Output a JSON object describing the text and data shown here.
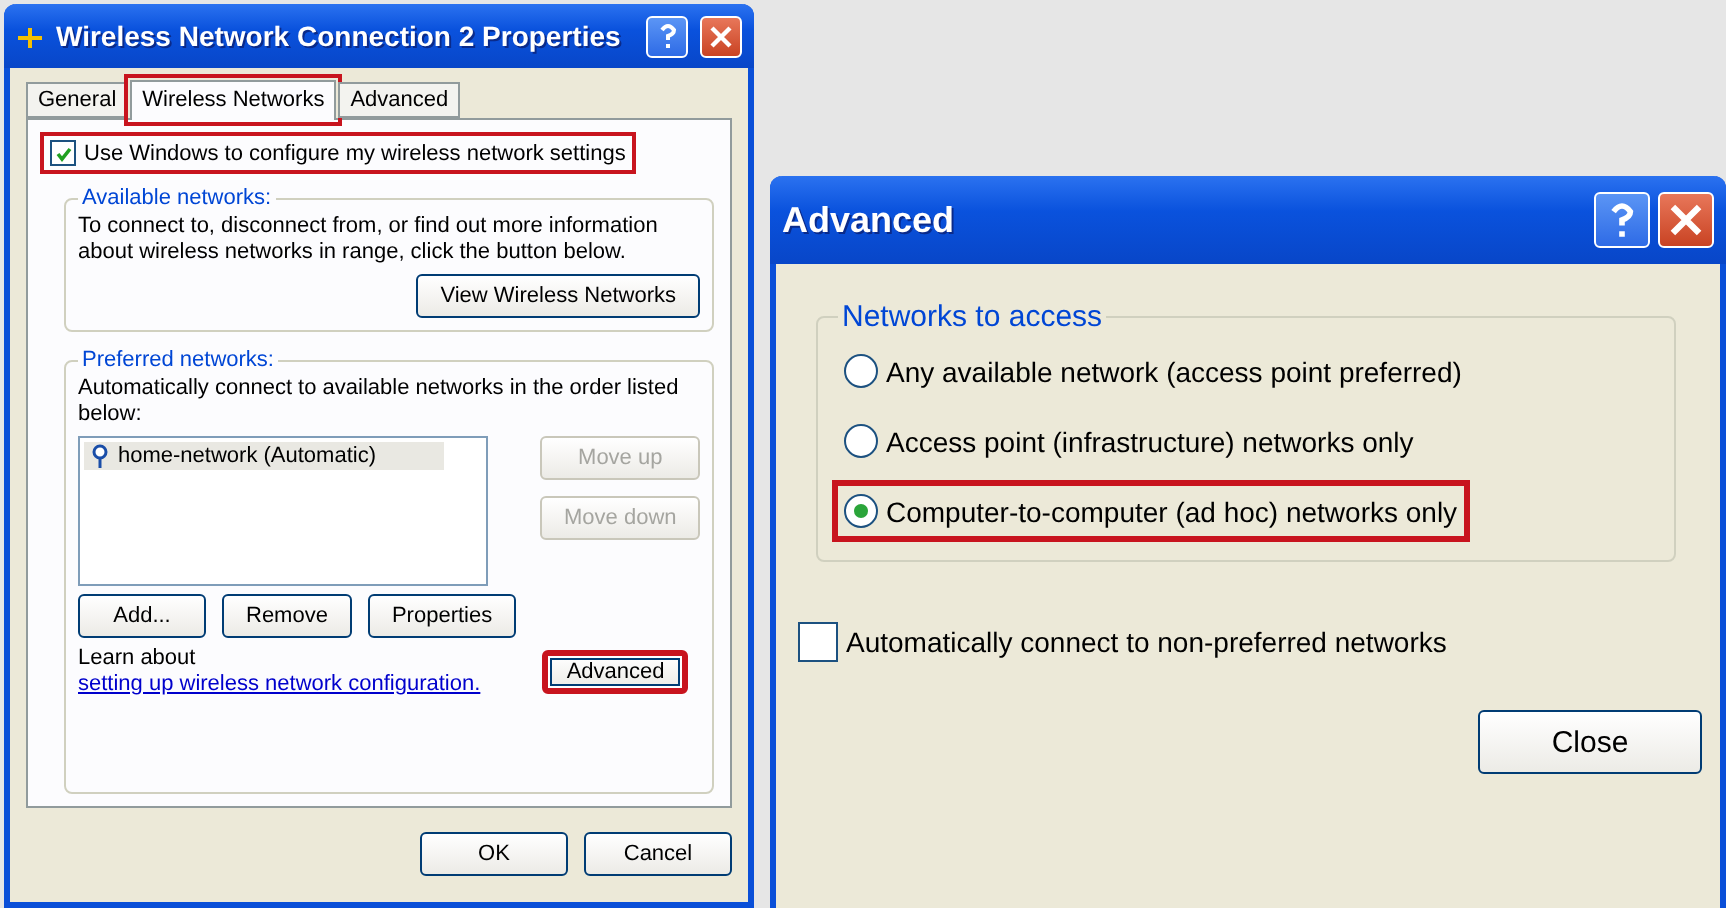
{
  "properties_window": {
    "title": "Wireless Network Connection 2 Properties",
    "tabs": [
      {
        "label": "General",
        "selected": false,
        "highlighted": false
      },
      {
        "label": "Wireless Networks",
        "selected": true,
        "highlighted": true
      },
      {
        "label": "Advanced",
        "selected": false,
        "highlighted": false
      }
    ],
    "use_windows": {
      "label": "Use Windows to configure my wireless network settings",
      "checked": true,
      "highlighted": true
    },
    "available": {
      "legend": "Available networks:",
      "text": "To connect to, disconnect from, or find out more information about wireless networks in range, click the button below.",
      "button": "View Wireless Networks"
    },
    "preferred": {
      "legend": "Preferred networks:",
      "text": "Automatically connect to available networks in the order listed below:",
      "networks": [
        {
          "label": "home-network (Automatic)",
          "selected": true
        }
      ],
      "side_buttons": [
        {
          "label": "Move up",
          "disabled": true
        },
        {
          "label": "Move down",
          "disabled": true
        }
      ],
      "buttons": [
        {
          "label": "Add...",
          "highlighted": false
        },
        {
          "label": "Remove",
          "highlighted": false
        },
        {
          "label": "Properties",
          "highlighted": false
        }
      ],
      "learn_text": "Learn about",
      "learn_link": "setting up wireless network configuration.",
      "advanced_button": {
        "label": "Advanced",
        "highlighted": true
      }
    },
    "footer_buttons": [
      "OK",
      "Cancel"
    ]
  },
  "advanced_window": {
    "title": "Advanced",
    "group": {
      "legend": "Networks to access",
      "options": [
        {
          "label": "Any available network (access point preferred)",
          "selected": false,
          "highlighted": false
        },
        {
          "label": "Access point (infrastructure) networks only",
          "selected": false,
          "highlighted": false
        },
        {
          "label": "Computer-to-computer (ad hoc) networks only",
          "selected": true,
          "highlighted": true
        }
      ]
    },
    "auto_connect": {
      "label": "Automatically connect to non-preferred networks",
      "checked": false
    },
    "close_button": "Close"
  }
}
